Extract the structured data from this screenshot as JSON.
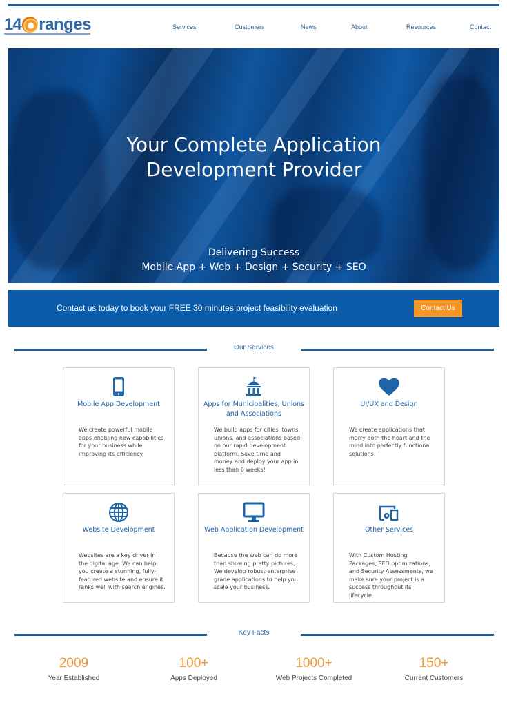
{
  "brand": {
    "logo_prefix": "14",
    "logo_word": "ranges",
    "colors": {
      "primary": "#1f5e98",
      "accent": "#f39624",
      "band": "#0a5ba8",
      "fact_number": "#ef9a35"
    }
  },
  "nav": {
    "items": [
      {
        "label": "Services"
      },
      {
        "label": "Customers"
      },
      {
        "label": "News"
      },
      {
        "label": "About"
      },
      {
        "label": "Resources"
      },
      {
        "label": "Contact"
      }
    ]
  },
  "hero": {
    "title_line1": "Your Complete Application",
    "title_line2": "Development Provider",
    "subtitle": "Delivering Success",
    "tagline": "Mobile App + Web + Design + Security + SEO"
  },
  "cta": {
    "text": "Contact us today to book your FREE 30 minutes project feasibility evaluation",
    "button_label": "Contact Us"
  },
  "services": {
    "heading": "Our Services",
    "cards": [
      {
        "icon": "smartphone-icon",
        "title": "Mobile App Development",
        "description": "We create powerful mobile apps enabling new capabilities for your business while improving its efficiency."
      },
      {
        "icon": "town-hall-icon",
        "title": "Apps for Municipalities, Unions and Associations",
        "description": "We build apps for cities, towns, unions, and associations based on our rapid development platform. Save time and money and deploy your app in less than 6 weeks!"
      },
      {
        "icon": "heart-icon",
        "title": "UI/UX and Design",
        "description": "We create applications that marry both the heart and the mind into perfectly functional solutions."
      },
      {
        "icon": "globe-icon",
        "title": "Website Development",
        "description": "Websites are a key driver in the digital age. We can help you create a stunning, fully-featured website and ensure it ranks well with search engines."
      },
      {
        "icon": "monitor-icon",
        "title": "Web Application Development",
        "description": "Because the web can do more than showing pretty pictures, We develop robust enterprise grade applications to help you scale your business."
      },
      {
        "icon": "devices-icon",
        "title": "Other Services",
        "description": "With Custom Hosting Packages, SEO optimizations, and Security Assessments, we make sure your project is a success throughout its lifecycle."
      }
    ]
  },
  "facts": {
    "heading": "Key Facts",
    "items": [
      {
        "value": "2009",
        "label": "Year Established"
      },
      {
        "value": "100+",
        "label": "Apps Deployed"
      },
      {
        "value": "1000+",
        "label": "Web Projects Completed"
      },
      {
        "value": "150+",
        "label": "Current Customers"
      }
    ]
  }
}
